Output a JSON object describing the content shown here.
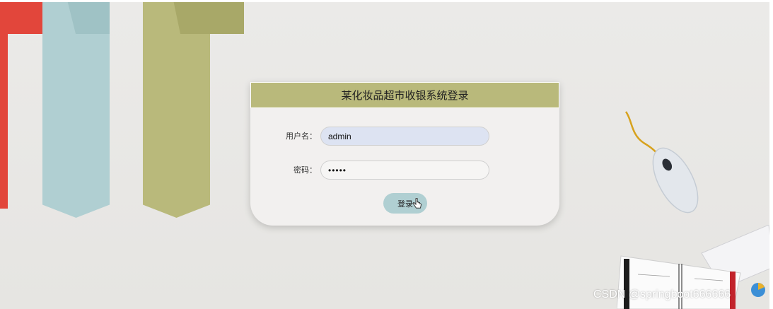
{
  "login": {
    "title": "某化妆品超市收银系统登录",
    "username_label": "用户名：",
    "username_value": "admin",
    "password_label": "密码：",
    "password_value": "•••••",
    "submit_label": "登录"
  },
  "watermark": {
    "text": "CSDN @springboot666666"
  },
  "colors": {
    "header_olive": "#b9b97b",
    "button_blue": "#b0cfd2",
    "ribbon_red": "#e2463b",
    "ribbon_blue": "#b0cfd2",
    "ribbon_olive": "#b9b97b",
    "username_input_bg": "#dde3f2"
  }
}
